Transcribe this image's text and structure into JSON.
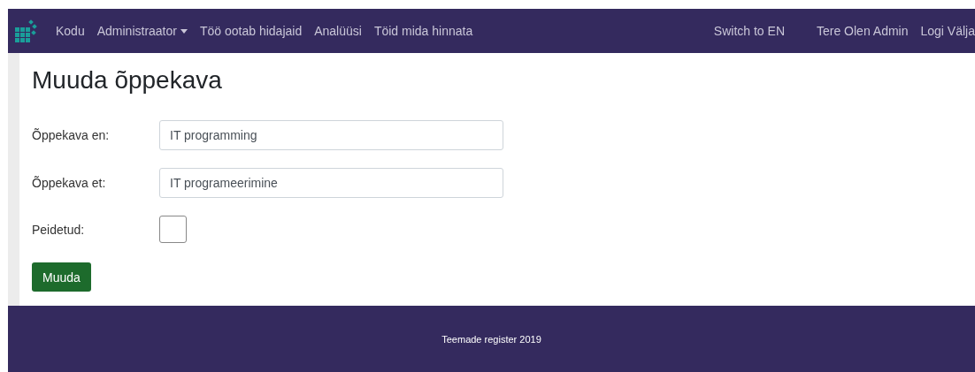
{
  "navbar": {
    "left_links": [
      {
        "label": "Kodu",
        "kind": "link"
      },
      {
        "label": "Administraator",
        "kind": "dropdown"
      },
      {
        "label": "Töö ootab hidajaid",
        "kind": "link"
      },
      {
        "label": "Analüüsi",
        "kind": "link"
      },
      {
        "label": "Töid mida hinnata",
        "kind": "link"
      }
    ],
    "right_links": [
      {
        "label": "Switch to EN"
      },
      {
        "label": "Tere Olen Admin"
      },
      {
        "label": "Logi Välja"
      }
    ]
  },
  "page": {
    "title": "Muuda õppekava",
    "fields": [
      {
        "kind": "text",
        "label": "Õppekava en:",
        "value": "IT programming"
      },
      {
        "kind": "text",
        "label": "Õppekava et:",
        "value": "IT programeerimine"
      },
      {
        "kind": "checkbox",
        "label": "Peidetud:",
        "checked": false
      }
    ],
    "submit": "Muuda"
  },
  "footer": {
    "text": "Teemade register 2019"
  }
}
